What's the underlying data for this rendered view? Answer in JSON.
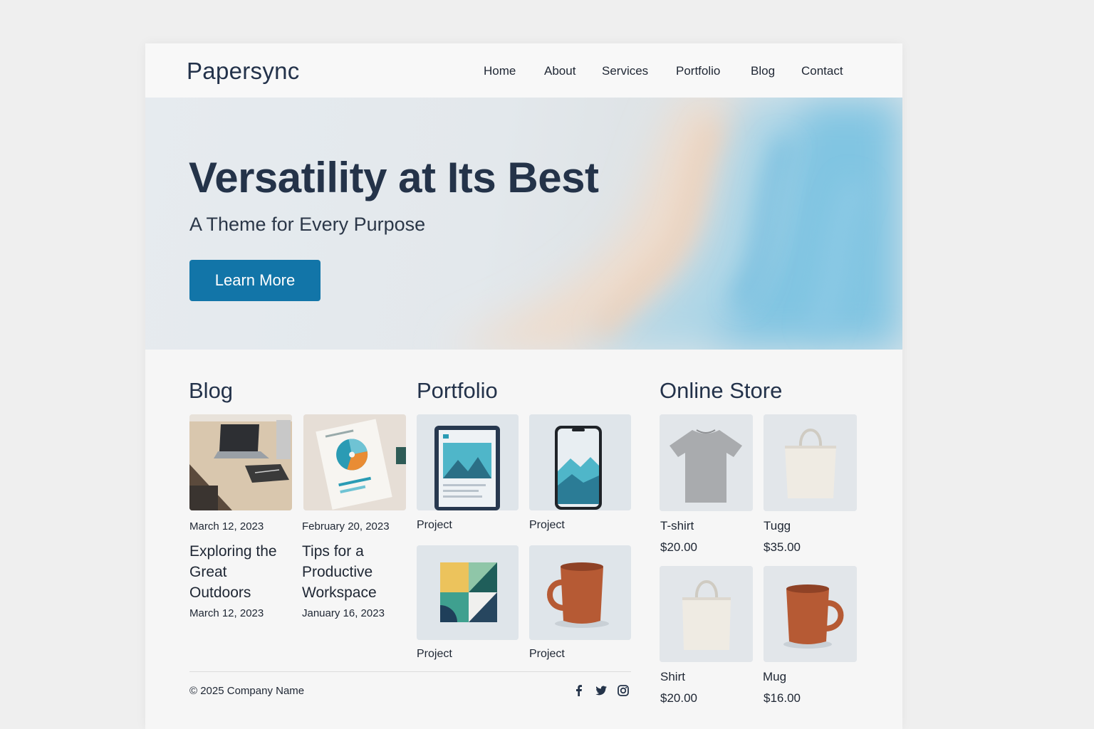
{
  "brand": {
    "name": "Papersync"
  },
  "nav": {
    "items": [
      {
        "label": "Home"
      },
      {
        "label": "About"
      },
      {
        "label": "Services"
      },
      {
        "label": "Portfolio"
      },
      {
        "label": "Blog"
      },
      {
        "label": "Contact"
      }
    ]
  },
  "hero": {
    "title": "Versatility at Its Best",
    "subtitle": "A Theme for Every Purpose",
    "cta_label": "Learn More",
    "cta_color": "#1275a8"
  },
  "blog": {
    "title": "Blog",
    "posts": [
      {
        "date_top": "March 12, 2023",
        "title": "Exploring the Great Outdoors",
        "date_bottom": "March 12, 2023",
        "image": "desk-laptop-notebook"
      },
      {
        "date_top": "February 20, 2023",
        "title": "Tips for a Productive Workspace",
        "date_bottom": "January 16, 2023",
        "image": "report-pie-chart"
      }
    ]
  },
  "portfolio": {
    "title": "Portfolio",
    "items": [
      {
        "caption": "Project",
        "image": "tablet-mockup"
      },
      {
        "caption": "Project",
        "image": "phone-mockup"
      },
      {
        "caption": "Project",
        "image": "geometric-art"
      },
      {
        "caption": "Project",
        "image": "mug"
      }
    ]
  },
  "store": {
    "title": "Online Store",
    "products": [
      {
        "name": "T-shirt",
        "price": "$20.00",
        "image": "t-shirt"
      },
      {
        "name": "Tugg",
        "price": "$35.00",
        "image": "tote-bag"
      },
      {
        "name": "Shirt",
        "price": "$20.00",
        "image": "tote-bag"
      },
      {
        "name": "Mug",
        "price": "$16.00",
        "image": "mug"
      }
    ]
  },
  "footer": {
    "copyright": "© 2025 Company Name",
    "social": [
      "facebook-icon",
      "twitter-icon",
      "instagram-icon"
    ]
  }
}
